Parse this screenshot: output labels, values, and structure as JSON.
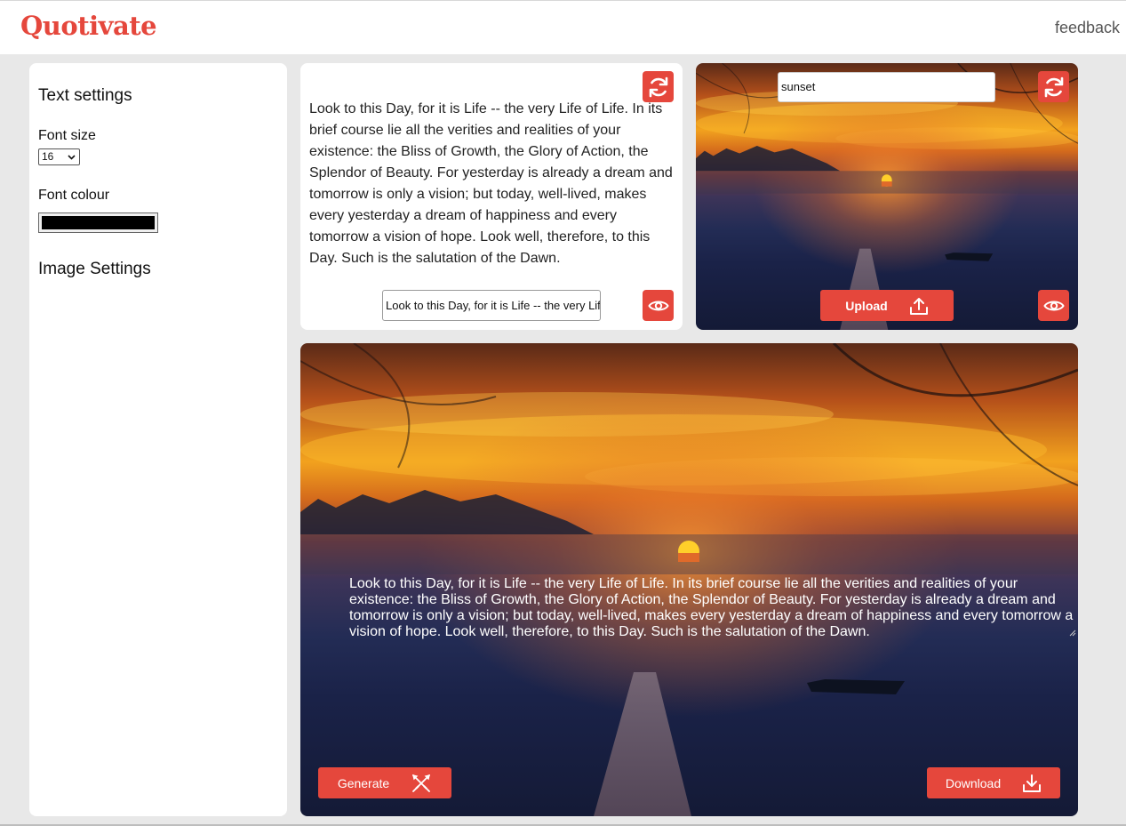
{
  "app": {
    "logo": "Quotivate",
    "feedback_label": "feedback"
  },
  "sidebar": {
    "text_settings_heading": "Text settings",
    "font_size_label": "Font size",
    "font_size_value": "16",
    "font_colour_label": "Font colour",
    "font_colour_value": "#000000",
    "image_settings_heading": "Image Settings"
  },
  "quote_panel": {
    "quote_text": "Look to this Day, for it is Life -- the very Life of Life. In its brief course lie all the verities and realities of your existence: the Bliss of Growth, the Glory of Action, the Splendor of Beauty. For yesterday is already a dream and tomorrow is only a vision; but today, well-lived, makes every yesterday a dream of happiness and every tomorrow a vision of hope. Look well, therefore, to this Day. Such is the salutation of the Dawn.",
    "quote_input_value": "Look to this Day, for it is Life -- the very Life of Life. In its brief course"
  },
  "image_panel": {
    "search_value": "sunset",
    "upload_label": "Upload"
  },
  "canvas_panel": {
    "overlay_text": "Look to this Day, for it is Life -- the very Life of Life. In its brief course lie all the verities and realities of your existence: the Bliss of Growth, the Glory of Action, the Splendor of Beauty. For yesterday is already a dream and tomorrow is only a vision; but today, well-lived, makes every yesterday a dream of happiness and every tomorrow a vision of hope. Look well, therefore, to this Day. Such is the salutation of the Dawn.",
    "generate_label": "Generate",
    "download_label": "Download"
  },
  "colors": {
    "accent": "#e5473c",
    "background": "#e8e8e8",
    "panel": "#ffffff"
  },
  "icons": [
    "refresh-icon",
    "eye-icon",
    "upload-icon",
    "generate-icon",
    "download-icon",
    "chevron-down-icon"
  ]
}
